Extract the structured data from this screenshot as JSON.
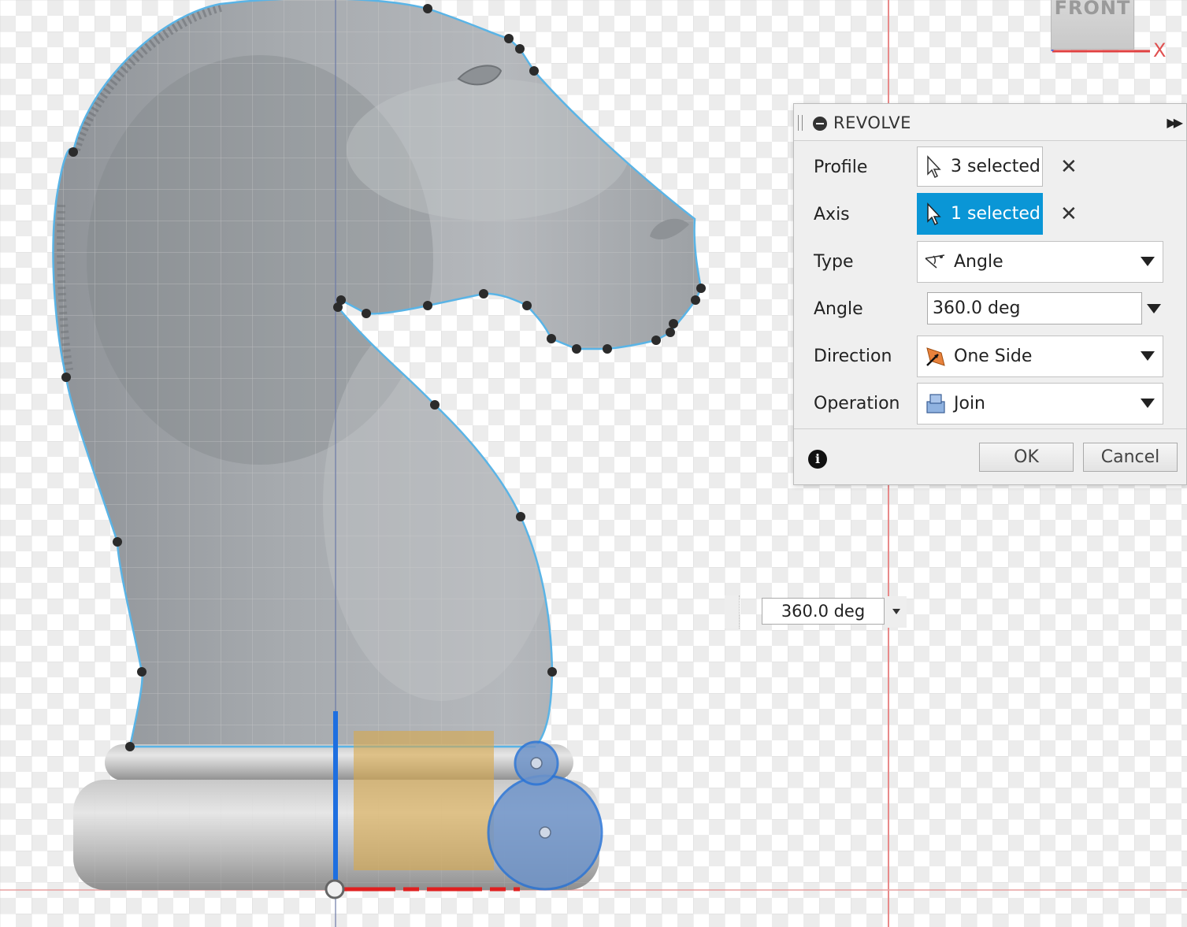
{
  "view_cube": {
    "face_label": "FRONT",
    "axis_label": "X"
  },
  "revolve_panel": {
    "title": "REVOLVE",
    "rows": {
      "profile": {
        "label": "Profile",
        "value": "3 selected",
        "icon": "cursor-arrow-icon"
      },
      "axis": {
        "label": "Axis",
        "value": "1 selected",
        "icon": "cursor-arrow-icon",
        "active": true
      },
      "type": {
        "label": "Type",
        "value": "Angle",
        "icon": "angle-icon"
      },
      "angle": {
        "label": "Angle",
        "value": "360.0 deg"
      },
      "direction": {
        "label": "Direction",
        "value": "One Side",
        "icon": "one-side-direction-icon"
      },
      "operation": {
        "label": "Operation",
        "value": "Join",
        "icon": "join-body-icon"
      }
    },
    "buttons": {
      "ok": "OK",
      "cancel": "Cancel"
    }
  },
  "canvas_value_input": {
    "value": "360.0 deg"
  },
  "colors": {
    "selection_blue": "#0a96d6",
    "sketch_line": "#5ab4e6",
    "axis_x": "#e02020",
    "axis_y": "#1e6fe0",
    "profile_highlight": "#d9a94a"
  }
}
